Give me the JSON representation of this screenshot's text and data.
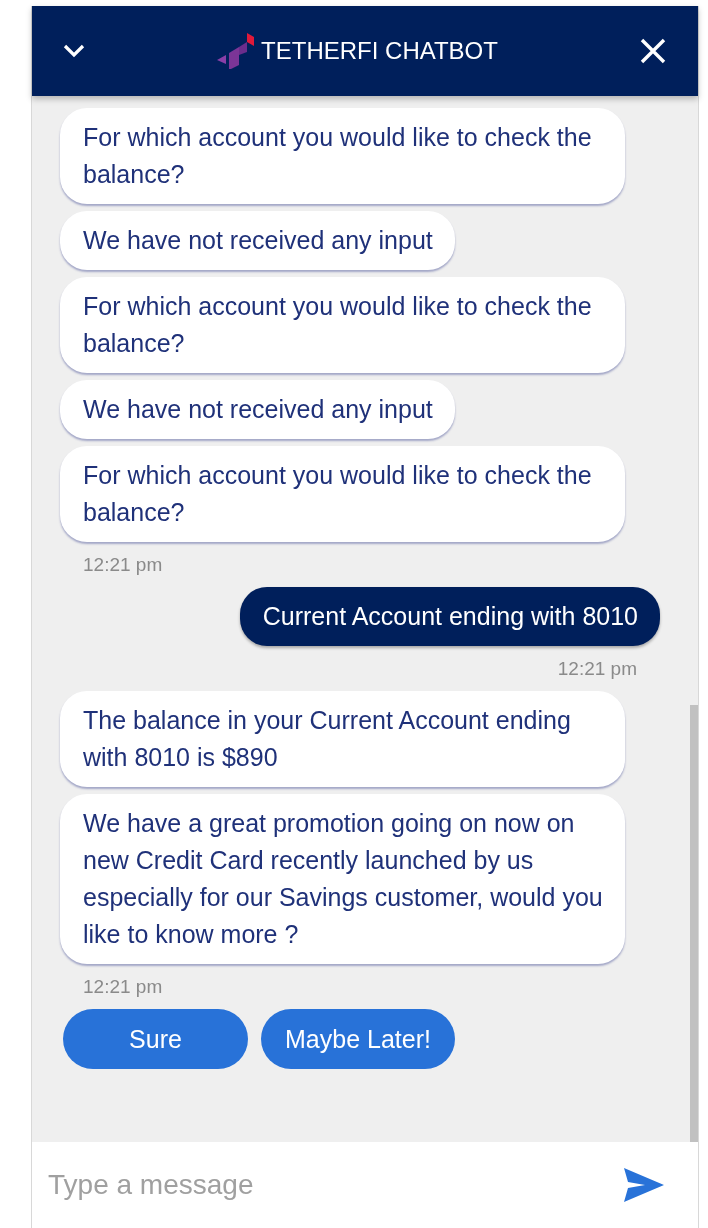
{
  "header": {
    "title": "TETHERFI CHATBOT"
  },
  "messages": [
    {
      "kind": "bot",
      "text": "For which account you would like to check the balance?"
    },
    {
      "kind": "bot",
      "text": "We have not received any input"
    },
    {
      "kind": "bot",
      "text": "For which account you would like to check the balance?"
    },
    {
      "kind": "bot",
      "text": "We have not received any input"
    },
    {
      "kind": "bot",
      "text": "For which account you would like to check the balance?"
    },
    {
      "kind": "bot_time",
      "text": "12:21 pm"
    },
    {
      "kind": "user",
      "text": "Current Account ending with 8010"
    },
    {
      "kind": "user_time",
      "text": "12:21 pm"
    },
    {
      "kind": "bot",
      "text": "The balance in your Current Account ending with 8010 is $890"
    },
    {
      "kind": "bot",
      "text": "We have a great promotion going on now on new Credit Card recently launched by us especially for our Savings customer, would you like to know more ?"
    },
    {
      "kind": "bot_time",
      "text": "12:21 pm"
    }
  ],
  "quick_replies": [
    "Sure",
    "Maybe Later!"
  ],
  "composer": {
    "placeholder": "Type a message"
  }
}
